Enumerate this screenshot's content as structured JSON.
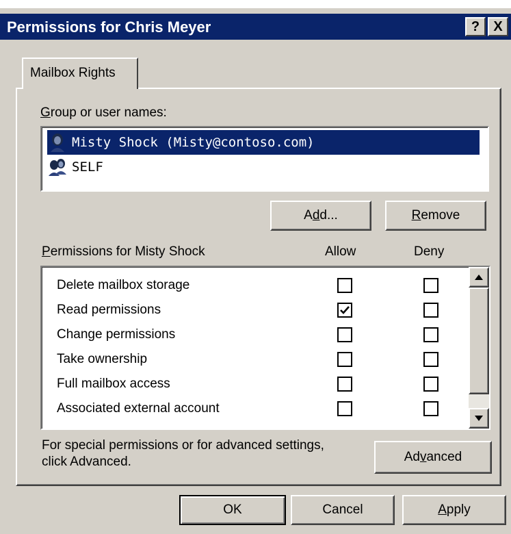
{
  "window": {
    "title": "Permissions for Chris Meyer",
    "help_glyph": "?",
    "close_glyph": "X"
  },
  "tab": {
    "label": "Mailbox Rights"
  },
  "users_section": {
    "label_prefix": "G",
    "label_rest": "roup or user names:",
    "items": [
      {
        "name": "Misty Shock (Misty@contoso.com)",
        "selected": true,
        "icon": "user-icon"
      },
      {
        "name": "SELF",
        "selected": false,
        "icon": "group-icon"
      }
    ]
  },
  "buttons": {
    "add_pre": "A",
    "add_ul": "d",
    "add_post": "d...",
    "remove_ul": "R",
    "remove_post": "emove",
    "advanced_pre": "Ad",
    "advanced_ul": "v",
    "advanced_post": "anced",
    "ok": "OK",
    "cancel": "Cancel",
    "apply_ul": "A",
    "apply_post": "pply"
  },
  "permissions": {
    "header_ul": "P",
    "header_rest": "ermissions for Misty Shock",
    "allow_label": "Allow",
    "deny_label": "Deny",
    "rows": [
      {
        "label": "Delete mailbox storage",
        "allow": false,
        "deny": false
      },
      {
        "label": "Read permissions",
        "allow": true,
        "deny": false
      },
      {
        "label": "Change permissions",
        "allow": false,
        "deny": false
      },
      {
        "label": "Take ownership",
        "allow": false,
        "deny": false
      },
      {
        "label": "Full mailbox access",
        "allow": false,
        "deny": false
      },
      {
        "label": "Associated external account",
        "allow": false,
        "deny": false
      }
    ]
  },
  "special_note": {
    "line1": "For special permissions or for advanced settings,",
    "line2": "click Advanced."
  },
  "colors": {
    "titlebar": "#0a246a",
    "face": "#d4d0c8",
    "selection": "#0a246a"
  }
}
